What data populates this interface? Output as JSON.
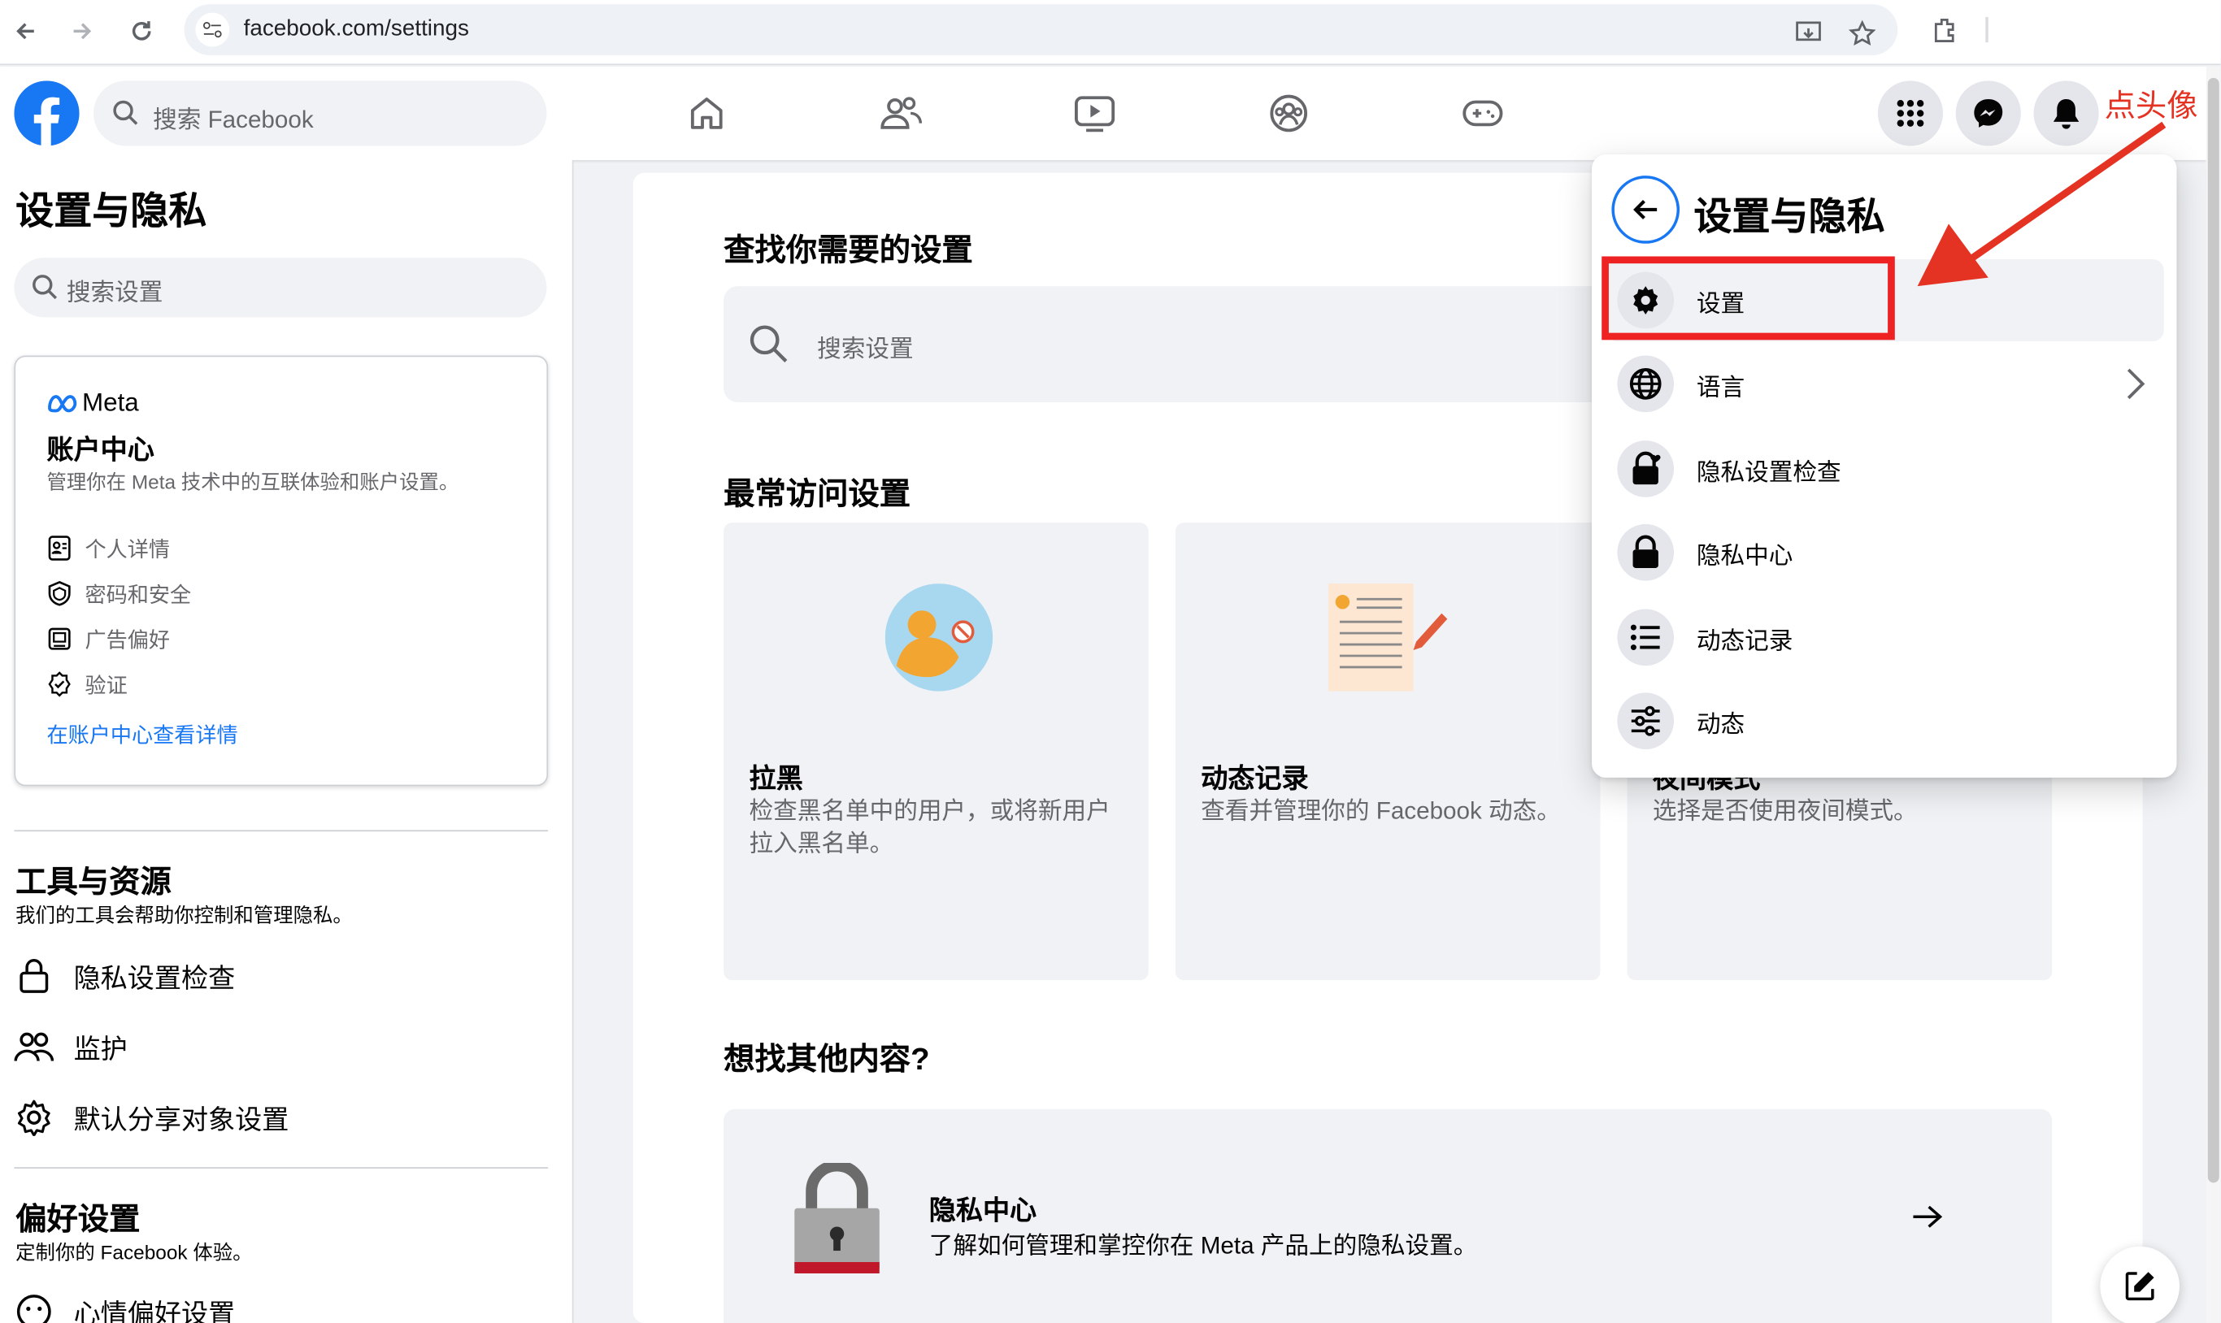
{
  "browser": {
    "url": "facebook.com/settings"
  },
  "topbar": {
    "search_placeholder": "搜索 Facebook",
    "nav_icons": [
      "home-icon",
      "friends-icon",
      "watch-icon",
      "groups-icon",
      "gaming-icon"
    ],
    "right_buttons": [
      "menu-grid-icon",
      "messenger-icon",
      "notifications-icon"
    ],
    "annotation_text": "点头像"
  },
  "sidebar": {
    "title": "设置与隐私",
    "search_placeholder": "搜索设置",
    "account_center": {
      "brand": "Meta",
      "title": "账户中心",
      "description": "管理你在 Meta 技术中的互联体验和账户设置。",
      "items": [
        {
          "label": "个人详情",
          "icon": "id-card-icon"
        },
        {
          "label": "密码和安全",
          "icon": "shield-icon"
        },
        {
          "label": "广告偏好",
          "icon": "ad-icon"
        },
        {
          "label": "验证",
          "icon": "verified-icon"
        }
      ],
      "link": "在账户中心查看详情"
    },
    "tools": {
      "title": "工具与资源",
      "description": "我们的工具会帮助你控制和管理隐私。",
      "items": [
        {
          "label": "隐私设置检查",
          "icon": "lock-icon"
        },
        {
          "label": "监护",
          "icon": "supervision-icon"
        },
        {
          "label": "默认分享对象设置",
          "icon": "gear-icon"
        }
      ]
    },
    "preferences": {
      "title": "偏好设置",
      "description": "定制你的 Facebook 体验。",
      "items": [
        {
          "label": "心情偏好设置",
          "icon": "reaction-icon"
        }
      ]
    }
  },
  "main": {
    "find_title": "查找你需要的设置",
    "search_placeholder": "搜索设置",
    "frequent_title": "最常访问设置",
    "cards": [
      {
        "title": "拉黑",
        "description": "检查黑名单中的用户，或将新用户拉入黑名单。"
      },
      {
        "title": "动态记录",
        "description": "查看并管理你的 Facebook 动态。"
      },
      {
        "title": "夜间模式",
        "description": "选择是否使用夜间模式。"
      }
    ],
    "other_title": "想找其他内容?",
    "privacy_center": {
      "title": "隐私中心",
      "description": "了解如何管理和掌控你在 Meta 产品上的隐私设置。"
    }
  },
  "dropdown": {
    "title": "设置与隐私",
    "items": [
      {
        "label": "设置",
        "icon": "gear-icon"
      },
      {
        "label": "语言",
        "icon": "globe-icon"
      },
      {
        "label": "隐私设置检查",
        "icon": "lock-heart-icon"
      },
      {
        "label": "隐私中心",
        "icon": "lock-icon"
      },
      {
        "label": "动态记录",
        "icon": "list-icon"
      },
      {
        "label": "动态",
        "icon": "sliders-icon"
      }
    ]
  },
  "colors": {
    "brand_blue": "#1877f2",
    "annotation_red": "#ee2222",
    "page_background": "#f0f2f5"
  }
}
